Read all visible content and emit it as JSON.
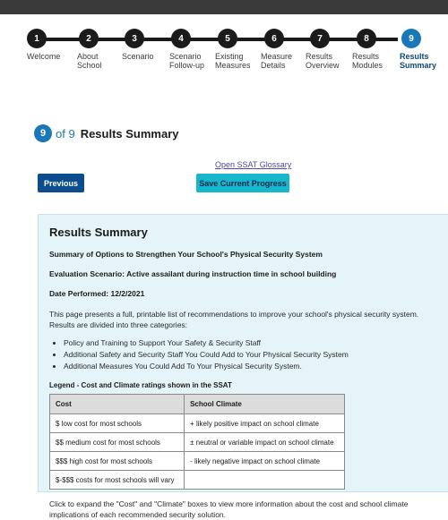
{
  "steps": [
    {
      "num": "1",
      "label": "Welcome"
    },
    {
      "num": "2",
      "label": "About School"
    },
    {
      "num": "3",
      "label": "Scenario"
    },
    {
      "num": "4",
      "label": "Scenario Follow-up"
    },
    {
      "num": "5",
      "label": "Existing Measures"
    },
    {
      "num": "6",
      "label": "Measure Details"
    },
    {
      "num": "7",
      "label": "Results Overview"
    },
    {
      "num": "8",
      "label": "Results Modules"
    },
    {
      "num": "9",
      "label": "Results Summary"
    }
  ],
  "counter": {
    "current": "9",
    "of_text": "of 9",
    "title": "Results Summary"
  },
  "glossary_link": "Open SSAT Glossary",
  "buttons": {
    "previous": "Previous",
    "save": "Save Current Progress"
  },
  "summary": {
    "heading": "Results Summary",
    "subtitle": "Summary of Options to Strengthen Your School's Physical Security System",
    "scenario": "Evaluation Scenario: Active assailant during instruction time in school building",
    "date": "Date Performed: 12/2/2021",
    "intro": "This page presents a full, printable list of recommendations to improve your school's physical security system. Results are divided into three categories:",
    "categories": [
      "Policy and Training to Support Your Safety & Security Staff",
      "Additional Safety and Security Staff You Could Add to Your Physical Security System",
      "Additional Measures You Could Add To Your Physical Security System."
    ],
    "legend_title": "Legend - Cost and Climate ratings shown in the SSAT",
    "table": {
      "headers": [
        "Cost",
        "School Climate"
      ],
      "rows": [
        [
          "$ low cost for most schools",
          "+ likely positive impact on school climate"
        ],
        [
          "$$ medium cost for most schools",
          "± neutral or variable impact on school climate"
        ],
        [
          "$$$ high cost for most schools",
          "- likely negative impact on school climate"
        ],
        [
          "$-$$$ costs for most schools will vary",
          ""
        ]
      ]
    },
    "footer": "Click to expand the \"Cost\" and \"Climate\" boxes to view more information about the cost and school climate implications of each recommended security solution."
  }
}
